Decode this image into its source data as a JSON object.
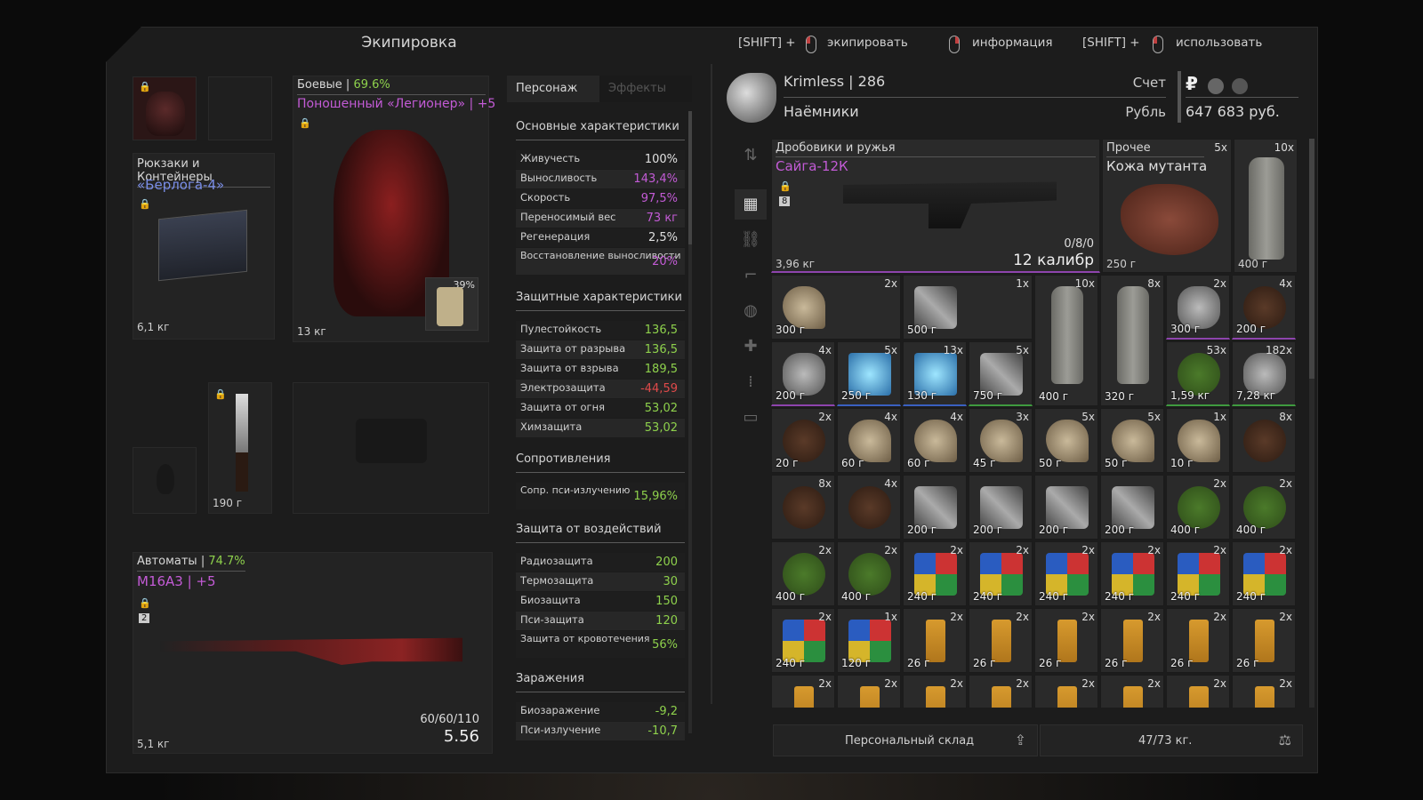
{
  "header": {
    "title": "Экипировка",
    "hints": [
      {
        "prefix": "[SHIFT] +",
        "action": "экипировать"
      },
      {
        "prefix": "",
        "action": "информация"
      },
      {
        "prefix": "[SHIFT] +",
        "action": "использовать"
      }
    ]
  },
  "equipment": {
    "backpack": {
      "category": "Рюкзаки и Контейнеры",
      "name": "«Берлога-4»",
      "weight": "6,1 кг"
    },
    "armor": {
      "category": "Боевые",
      "condition": "69.6%",
      "name": "Поношенный «Легионер» | +5",
      "weight": "13 кг",
      "plate": "39%"
    },
    "knife": {
      "weight": "190 г"
    },
    "primary": {
      "category": "Автоматы",
      "condition": "74.7%",
      "name": "М16А3 | +5",
      "slot_num": "2",
      "ammo": "60/60/110",
      "caliber": "5.56",
      "weight": "5,1 кг"
    }
  },
  "stats": {
    "tabs": [
      "Персонаж",
      "Эффекты"
    ],
    "sections": {
      "basic": "Основные характеристики",
      "protective": "Защитные характеристики",
      "resist": "Сопротивления",
      "exposure": "Защита от воздействий",
      "contamination": "Заражения"
    },
    "basic": [
      {
        "k": "Живучесть",
        "v": "100%",
        "c": "#e0e0e0"
      },
      {
        "k": "Выносливость",
        "v": "143,4%",
        "c": "#c35bd6"
      },
      {
        "k": "Скорость",
        "v": "97,5%",
        "c": "#c35bd6"
      },
      {
        "k": "Переносимый вес",
        "v": "73 кг",
        "c": "#c35bd6"
      },
      {
        "k": "Регенерация",
        "v": "2,5%",
        "c": "#e0e0e0"
      },
      {
        "k": "Восстановление выносливости",
        "v": "20%",
        "c": "#c35bd6"
      }
    ],
    "protective": [
      {
        "k": "Пулестойкость",
        "v": "136,5",
        "c": "#8ed14c"
      },
      {
        "k": "Защита от разрыва",
        "v": "136,5",
        "c": "#8ed14c"
      },
      {
        "k": "Защита от взрыва",
        "v": "189,5",
        "c": "#8ed14c"
      },
      {
        "k": "Электрозащита",
        "v": "-44,59",
        "c": "#e04a4a"
      },
      {
        "k": "Защита от огня",
        "v": "53,02",
        "c": "#8ed14c"
      },
      {
        "k": "Химзащита",
        "v": "53,02",
        "c": "#8ed14c"
      }
    ],
    "resist": [
      {
        "k": "Сопр. пси-излучению",
        "v": "15,96%",
        "c": "#8ed14c"
      }
    ],
    "exposure": [
      {
        "k": "Радиозащита",
        "v": "200",
        "c": "#8ed14c"
      },
      {
        "k": "Термозащита",
        "v": "30",
        "c": "#8ed14c"
      },
      {
        "k": "Биозащита",
        "v": "150",
        "c": "#8ed14c"
      },
      {
        "k": "Пси-защита",
        "v": "120",
        "c": "#8ed14c"
      },
      {
        "k": "Защита от кровотечения",
        "v": "56%",
        "c": "#8ed14c"
      }
    ],
    "contamination": [
      {
        "k": "Биозаражение",
        "v": "-9,2",
        "c": "#8ed14c"
      },
      {
        "k": "Пси-излучение",
        "v": "-10,7",
        "c": "#8ed14c"
      }
    ]
  },
  "player": {
    "name": "Krimless",
    "level": "286",
    "faction": "Наёмники",
    "account_label": "Счет",
    "currency_label": "Рубль",
    "currency_symbol": "₽",
    "balance": "647 683 руб."
  },
  "inventory": {
    "big_items": [
      {
        "category": "Дробовики и ружья",
        "name": "Сайга-12К",
        "slot_num": "8",
        "ammo": "0/8/0",
        "caliber": "12 калибр",
        "weight": "3,96 кг"
      },
      {
        "category": "Прочее",
        "count": "5x",
        "name": "Кожа мутанта",
        "weight": "250 г"
      },
      {
        "count": "10x",
        "weight": "400 г"
      }
    ],
    "row2": [
      {
        "count": "2x",
        "weight": "300 г",
        "icon": "bone-icon"
      },
      {
        "count": "1x",
        "weight": "500 г",
        "icon": "case-icon"
      },
      {
        "count": "10x",
        "weight": "400 г",
        "icon": "bottle-icon"
      },
      {
        "count": "8x",
        "weight": "320 г",
        "icon": "bottle-icon"
      },
      {
        "count": "2x",
        "weight": "300 г",
        "icon": "device-icon"
      },
      {
        "count": "4x",
        "weight": "200 г",
        "icon": "flower-icon"
      }
    ],
    "row3": [
      {
        "count": "4x",
        "weight": "200 г",
        "icon": "rock-icon"
      },
      {
        "count": "5x",
        "weight": "250 г",
        "icon": "crystal-icon"
      },
      {
        "count": "13x",
        "weight": "130 г",
        "icon": "powder-icon"
      },
      {
        "count": "5x",
        "weight": "750 г",
        "icon": "box-icon"
      },
      {
        "weight": "400 г",
        "icon": "bottle-icon"
      },
      {
        "weight": "320 г",
        "icon": "bottle-icon"
      },
      {
        "count": "53x",
        "weight": "1,59 кг",
        "icon": "fern-icon"
      },
      {
        "count": "182x",
        "weight": "7,28 кг",
        "icon": "ore-icon"
      }
    ],
    "row4": [
      {
        "count": "2x",
        "weight": "20 г",
        "icon": "spine-icon"
      },
      {
        "count": "4x",
        "weight": "60 г",
        "icon": "fang-icon"
      },
      {
        "count": "4x",
        "weight": "60 г",
        "icon": "fang-icon"
      },
      {
        "count": "3x",
        "weight": "45 г",
        "icon": "fang-icon"
      },
      {
        "count": "5x",
        "weight": "50 г",
        "icon": "claw-icon"
      },
      {
        "count": "5x",
        "weight": "50 г",
        "icon": "claw-icon"
      },
      {
        "count": "1x",
        "weight": "10 г",
        "icon": "claw-icon"
      },
      {
        "count": "8x",
        "weight": "",
        "icon": "fur-icon"
      }
    ],
    "row5": [
      {
        "count": "8x",
        "weight": "",
        "icon": "fur-icon"
      },
      {
        "count": "4x",
        "weight": "",
        "icon": "fur-icon"
      },
      {
        "count": "",
        "weight": "200 г",
        "icon": "pliers-icon"
      },
      {
        "count": "",
        "weight": "200 г",
        "icon": "pliers-icon"
      },
      {
        "count": "",
        "weight": "200 г",
        "icon": "pliers-icon"
      },
      {
        "count": "",
        "weight": "200 г",
        "icon": "pliers-icon"
      },
      {
        "count": "2x",
        "weight": "400 г",
        "icon": "medkit-icon"
      },
      {
        "count": "2x",
        "weight": "400 г",
        "icon": "medkit-icon"
      }
    ],
    "row6": [
      {
        "count": "2x",
        "weight": "400 г",
        "icon": "medkit-icon"
      },
      {
        "count": "2x",
        "weight": "400 г",
        "icon": "medkit-icon"
      },
      {
        "count": "2x",
        "weight": "240 г",
        "icon": "cube-icon"
      },
      {
        "count": "2x",
        "weight": "240 г",
        "icon": "cube-icon"
      },
      {
        "count": "2x",
        "weight": "240 г",
        "icon": "cube-icon"
      },
      {
        "count": "2x",
        "weight": "240 г",
        "icon": "cube-icon"
      },
      {
        "count": "2x",
        "weight": "240 г",
        "icon": "cube-icon"
      },
      {
        "count": "2x",
        "weight": "240 г",
        "icon": "cube-icon"
      }
    ],
    "row7": [
      {
        "count": "2x",
        "weight": "240 г",
        "icon": "cube-icon"
      },
      {
        "count": "1x",
        "weight": "120 г",
        "icon": "cube-icon"
      },
      {
        "count": "2x",
        "weight": "26 г",
        "icon": "lighter-icon"
      },
      {
        "count": "2x",
        "weight": "26 г",
        "icon": "lighter-icon"
      },
      {
        "count": "2x",
        "weight": "26 г",
        "icon": "lighter-icon"
      },
      {
        "count": "2x",
        "weight": "26 г",
        "icon": "lighter-icon"
      },
      {
        "count": "2x",
        "weight": "26 г",
        "icon": "lighter-icon"
      },
      {
        "count": "2x",
        "weight": "26 г",
        "icon": "lighter-icon"
      }
    ],
    "row8": [
      {
        "count": "2x",
        "icon": "lighter-icon"
      },
      {
        "count": "2x",
        "icon": "lighter-icon"
      },
      {
        "count": "2x",
        "icon": "lighter-icon"
      },
      {
        "count": "2x",
        "icon": "lighter-icon"
      },
      {
        "count": "2x",
        "icon": "lighter-icon"
      },
      {
        "count": "2x",
        "icon": "lighter-icon"
      },
      {
        "count": "2x",
        "icon": "lighter-icon"
      },
      {
        "count": "2x",
        "icon": "lighter-icon"
      }
    ]
  },
  "footer": {
    "storage_button": "Персональный склад",
    "weight": "47/73 кг."
  }
}
